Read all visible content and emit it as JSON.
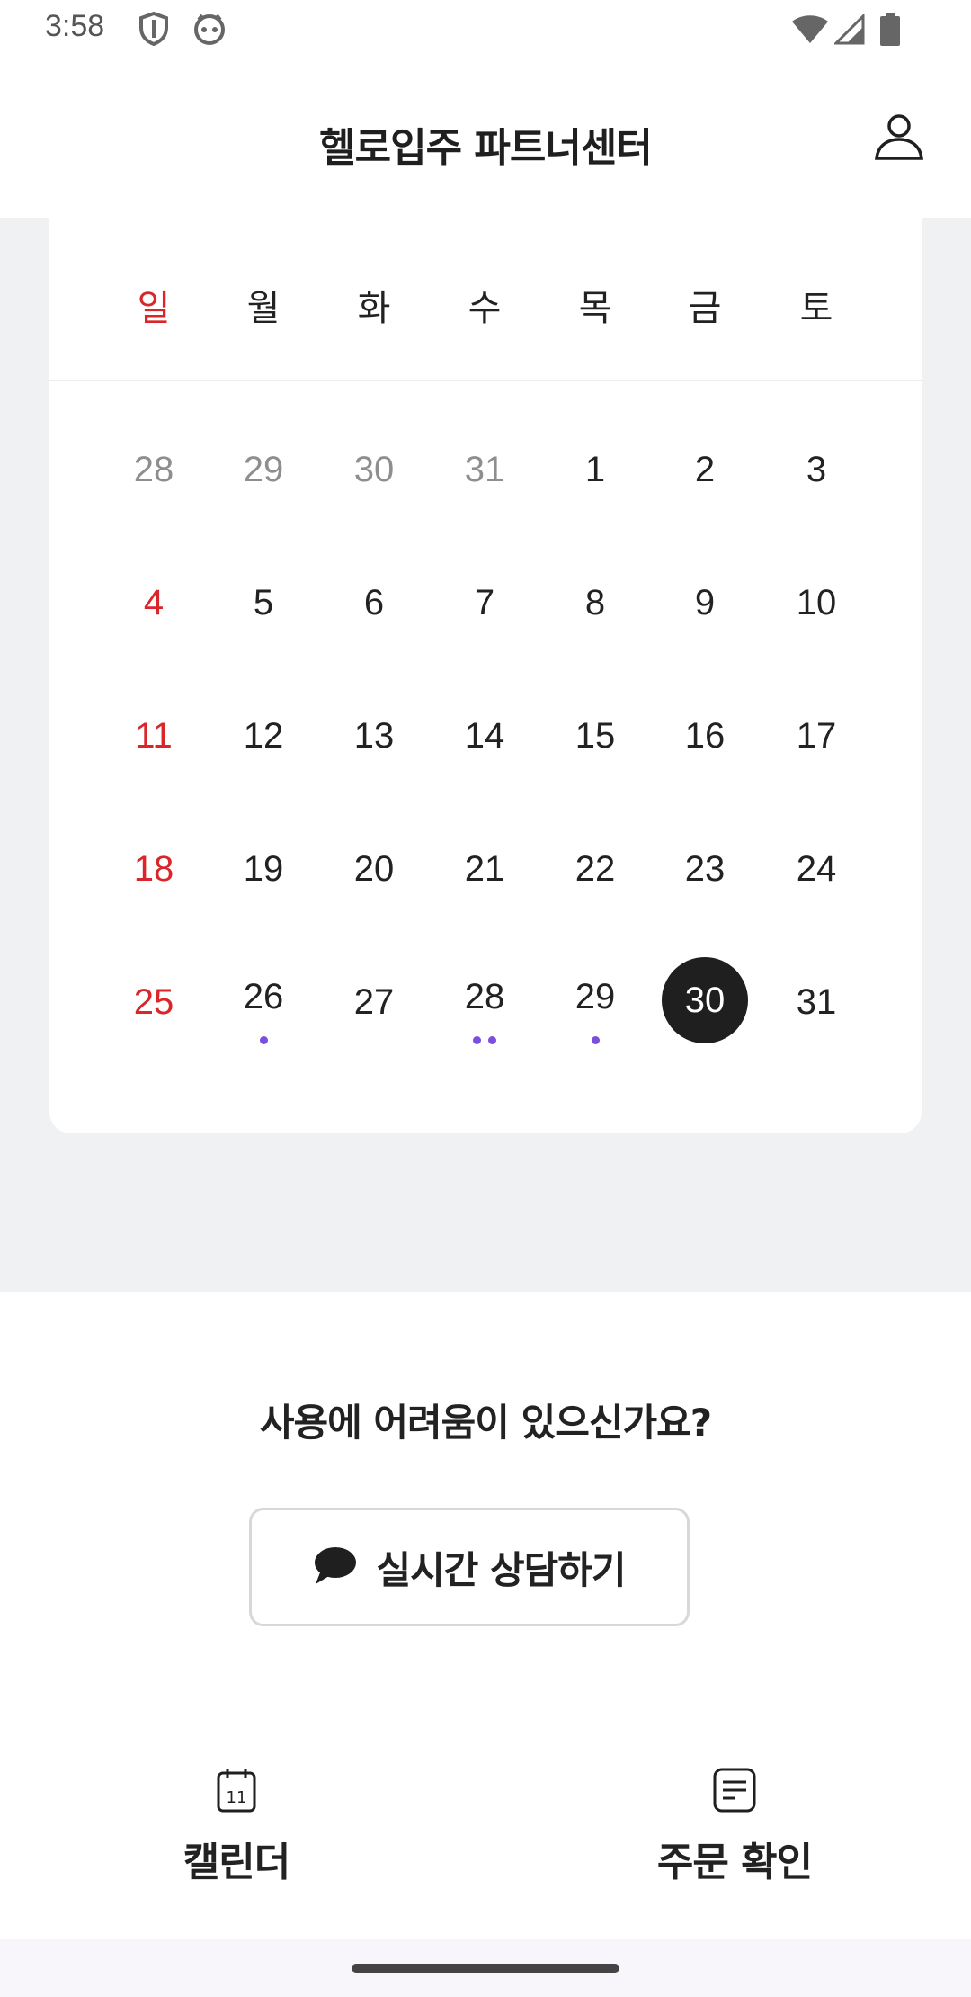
{
  "status_bar": {
    "time": "3:58"
  },
  "header": {
    "title": "헬로입주 파트너센터"
  },
  "calendar": {
    "weekdays": [
      "일",
      "월",
      "화",
      "수",
      "목",
      "금",
      "토"
    ],
    "weeks": [
      [
        {
          "label": "28",
          "state": "muted"
        },
        {
          "label": "29",
          "state": "muted"
        },
        {
          "label": "30",
          "state": "muted"
        },
        {
          "label": "31",
          "state": "muted"
        },
        {
          "label": "1",
          "state": "normal"
        },
        {
          "label": "2",
          "state": "normal"
        },
        {
          "label": "3",
          "state": "normal"
        }
      ],
      [
        {
          "label": "4",
          "state": "sunday"
        },
        {
          "label": "5",
          "state": "normal"
        },
        {
          "label": "6",
          "state": "normal"
        },
        {
          "label": "7",
          "state": "normal"
        },
        {
          "label": "8",
          "state": "normal"
        },
        {
          "label": "9",
          "state": "normal"
        },
        {
          "label": "10",
          "state": "normal"
        }
      ],
      [
        {
          "label": "11",
          "state": "sunday"
        },
        {
          "label": "12",
          "state": "normal"
        },
        {
          "label": "13",
          "state": "normal"
        },
        {
          "label": "14",
          "state": "normal"
        },
        {
          "label": "15",
          "state": "normal"
        },
        {
          "label": "16",
          "state": "normal"
        },
        {
          "label": "17",
          "state": "normal"
        }
      ],
      [
        {
          "label": "18",
          "state": "sunday"
        },
        {
          "label": "19",
          "state": "normal"
        },
        {
          "label": "20",
          "state": "normal"
        },
        {
          "label": "21",
          "state": "normal"
        },
        {
          "label": "22",
          "state": "normal"
        },
        {
          "label": "23",
          "state": "normal"
        },
        {
          "label": "24",
          "state": "normal"
        }
      ],
      [
        {
          "label": "25",
          "state": "sunday"
        },
        {
          "label": "26",
          "state": "normal",
          "events": 1
        },
        {
          "label": "27",
          "state": "normal"
        },
        {
          "label": "28",
          "state": "normal",
          "events": 2
        },
        {
          "label": "29",
          "state": "normal",
          "events": 1
        },
        {
          "label": "30",
          "state": "selected"
        },
        {
          "label": "31",
          "state": "normal"
        }
      ]
    ],
    "colors": {
      "sunday": "#d9262b",
      "muted": "#8e8e8e",
      "event_dot": "#7a4fe0",
      "selected_bg": "#1f1f1f"
    }
  },
  "help": {
    "question": "사용에 어려움이 있으신가요?",
    "chat_button_label": "실시간 상담하기",
    "chat_icon": "speech-bubble-icon"
  },
  "bottom_nav": {
    "items": [
      {
        "label": "캘린더",
        "icon": "calendar-icon"
      },
      {
        "label": "주문 확인",
        "icon": "document-list-icon"
      }
    ]
  }
}
